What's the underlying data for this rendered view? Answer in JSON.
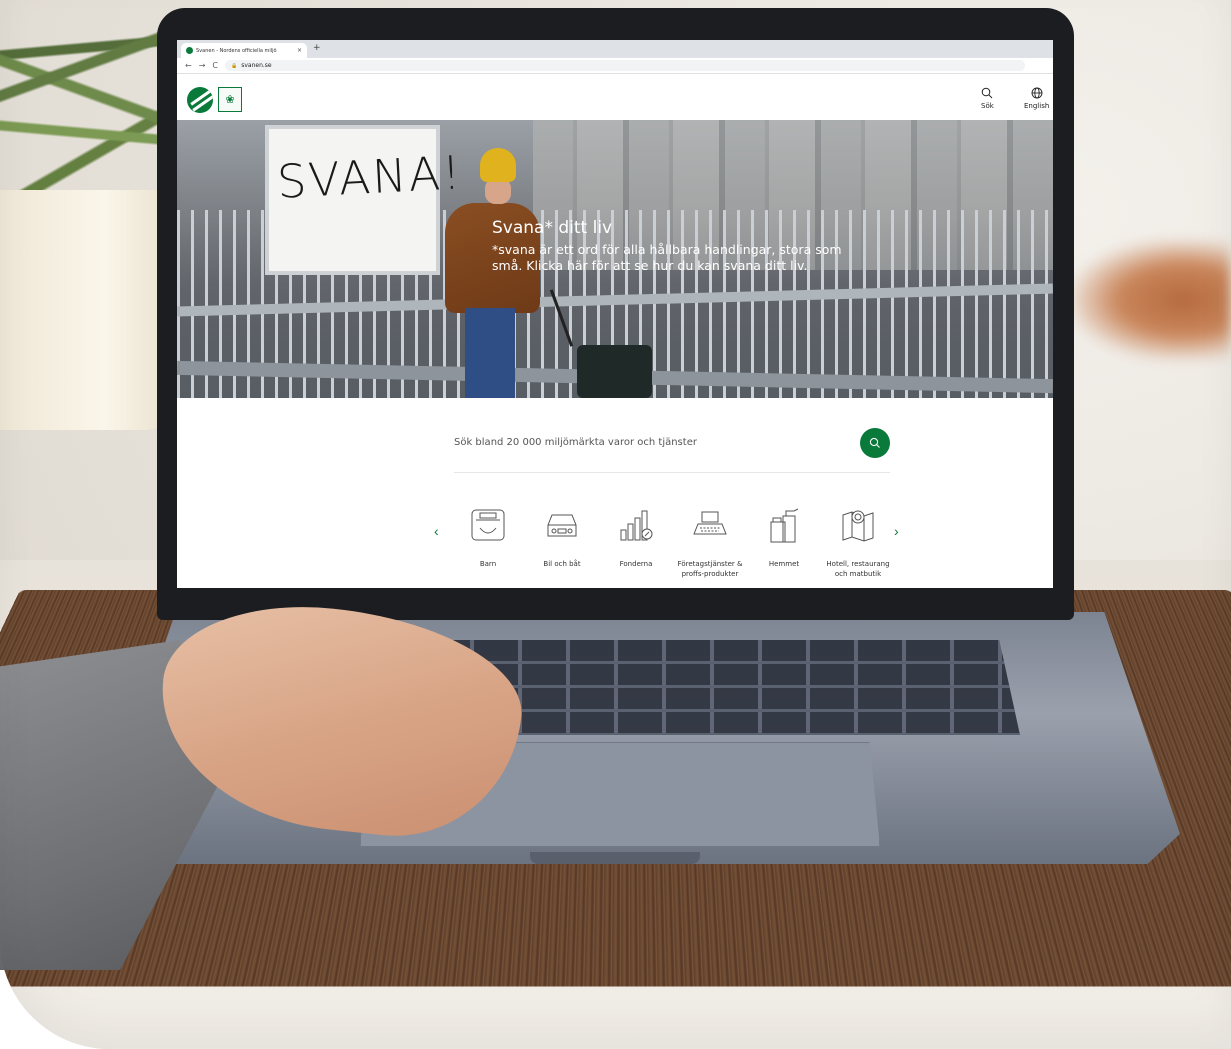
{
  "browser": {
    "tab_title": "Svanen - Nordens officiella miljö",
    "tab_close": "×",
    "new_tab": "+",
    "nav_back": "←",
    "nav_forward": "→",
    "nav_reload": "C",
    "url": "svanen.se"
  },
  "header": {
    "search_label": "Sök",
    "language_label": "English"
  },
  "hero": {
    "board_text": "SVANA!",
    "title": "Svana* ditt liv",
    "text": "*svana är ett ord för alla hållbara handlingar, stora som små. Klicka här för att se hur du kan svana ditt liv."
  },
  "search": {
    "placeholder": "Sök bland 20 000 miljömärkta varor och tjänster"
  },
  "categories": {
    "prev": "‹",
    "next": "›",
    "items": [
      {
        "label": "Barn"
      },
      {
        "label": "Bil och båt"
      },
      {
        "label": "Fonderna"
      },
      {
        "label": "Företagstjänster & proffs-produkter"
      },
      {
        "label": "Hemmet"
      },
      {
        "label": "Hotell, restaurang och matbutik"
      }
    ]
  },
  "colors": {
    "brand_green": "#0a7a3b"
  }
}
